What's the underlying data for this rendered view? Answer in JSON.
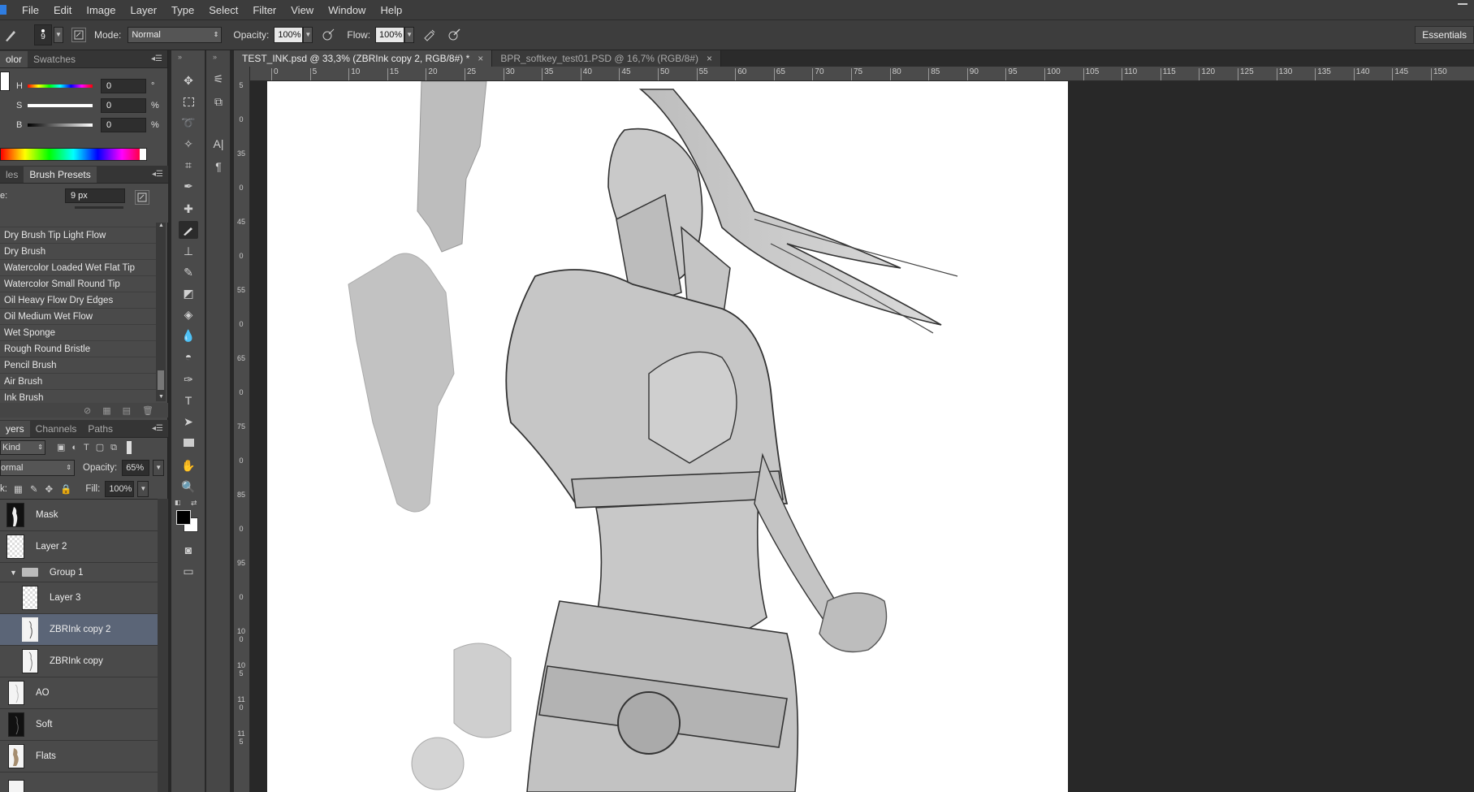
{
  "menu": [
    "File",
    "Edit",
    "Image",
    "Layer",
    "Type",
    "Select",
    "Filter",
    "View",
    "Window",
    "Help"
  ],
  "options": {
    "brush_size": "9",
    "mode_label": "Mode:",
    "mode_value": "Normal",
    "opacity_label": "Opacity:",
    "opacity_value": "100%",
    "flow_label": "Flow:",
    "flow_value": "100%",
    "workspace": "Essentials"
  },
  "color_panel": {
    "tabs": [
      "olor",
      "Swatches"
    ],
    "h_label": "H",
    "h_value": "0",
    "h_unit": "°",
    "s_label": "S",
    "s_value": "0",
    "s_unit": "%",
    "b_label": "B",
    "b_value": "0",
    "b_unit": "%"
  },
  "brush_panel": {
    "tabs": [
      "les",
      "Brush Presets"
    ],
    "size_label": "e:",
    "size_value": "9 px",
    "items": [
      "Dry Brush Tip Light Flow",
      "Dry Brush",
      "Watercolor Loaded Wet Flat Tip",
      "Watercolor Small Round Tip",
      "Oil Heavy Flow Dry Edges",
      "Oil Medium Wet Flow",
      "Wet Sponge",
      "Rough Round Bristle",
      "Pencil Brush",
      "Air Brush",
      "Ink Brush"
    ]
  },
  "layers_panel": {
    "tabs": [
      "yers",
      "Channels",
      "Paths"
    ],
    "kind_label": "Kind",
    "blend_mode": "ormal",
    "opacity_label": "Opacity:",
    "opacity_value": "65%",
    "lock_label": "k:",
    "fill_label": "Fill:",
    "fill_value": "100%",
    "layers": [
      {
        "name": "Mask",
        "selected": false
      },
      {
        "name": "Layer 2",
        "selected": false
      },
      {
        "name": "Group 1",
        "selected": false,
        "group": true
      },
      {
        "name": "Layer 3",
        "selected": false
      },
      {
        "name": "ZBRInk copy 2",
        "selected": true
      },
      {
        "name": "ZBRInk copy",
        "selected": false
      },
      {
        "name": "AO",
        "selected": false
      },
      {
        "name": "Soft",
        "selected": false
      },
      {
        "name": "Flats",
        "selected": false
      }
    ]
  },
  "documents": [
    {
      "title": "TEST_INK.psd @ 33,3% (ZBRInk copy 2, RGB/8#) *",
      "active": true
    },
    {
      "title": "BPR_softkey_test01.PSD @ 16,7% (RGB/8#)",
      "active": false
    }
  ],
  "ruler_top": [
    "0",
    "5",
    "10",
    "15",
    "20",
    "25",
    "30",
    "35",
    "40",
    "45",
    "50",
    "55",
    "60",
    "65",
    "70",
    "75",
    "80",
    "85",
    "90",
    "95",
    "100",
    "105",
    "110",
    "115",
    "120",
    "125",
    "130",
    "135",
    "140",
    "145",
    "150"
  ],
  "ruler_left": [
    "5",
    "0",
    "35",
    "0",
    "45",
    "0",
    "55",
    "0",
    "65",
    "0",
    "75",
    "0",
    "85",
    "0",
    "95",
    "0",
    "100",
    "105",
    "110",
    "115"
  ]
}
